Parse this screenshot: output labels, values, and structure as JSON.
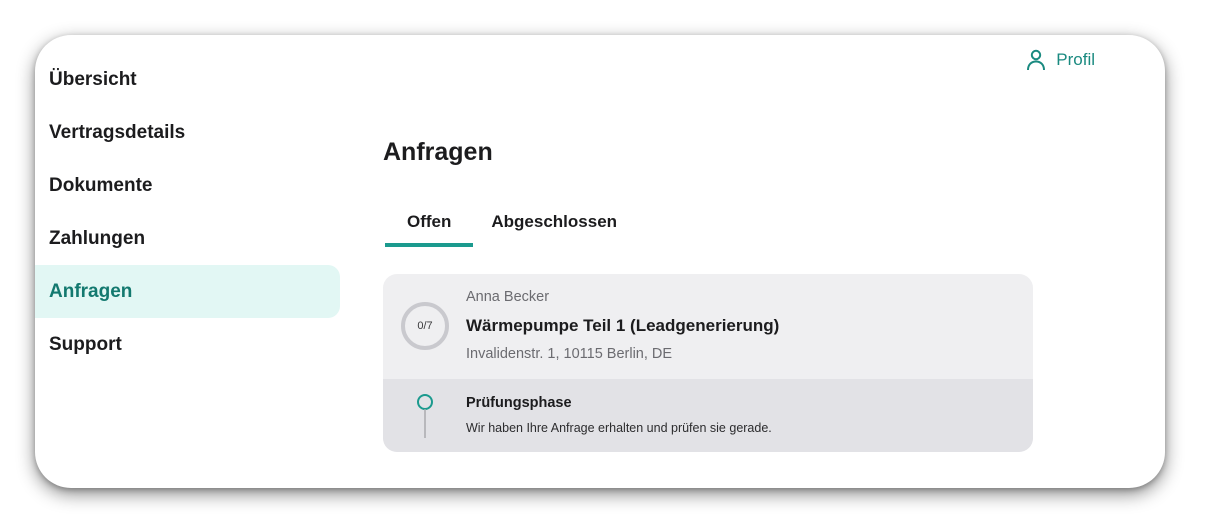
{
  "sidebar": {
    "items": [
      {
        "label": "Übersicht"
      },
      {
        "label": "Vertragsdetails"
      },
      {
        "label": "Dokumente"
      },
      {
        "label": "Zahlungen"
      },
      {
        "label": "Anfragen",
        "active": true
      },
      {
        "label": "Support"
      }
    ]
  },
  "header": {
    "profile_label": "Profil",
    "profile_icon": "user-icon"
  },
  "main": {
    "title": "Anfragen",
    "tabs": [
      {
        "label": "Offen",
        "active": true
      },
      {
        "label": "Abgeschlossen"
      }
    ],
    "request": {
      "progress_text": "0/7",
      "progress_done": 0,
      "progress_total": 7,
      "customer": "Anna Becker",
      "title": "Wärmepumpe Teil 1 (Leadgenerierung)",
      "address": "Invalidenstr. 1, 10115 Berlin, DE",
      "phase": {
        "title": "Prüfungsphase",
        "description": "Wir haben Ihre Anfrage erhalten und prüfen sie gerade.",
        "icon": "pin-icon"
      }
    }
  },
  "colors": {
    "accent": "#1b9a8e",
    "active_bg": "#e2f7f4",
    "card_bg": "#efeff1",
    "card_bottom_bg": "#e2e2e6"
  }
}
